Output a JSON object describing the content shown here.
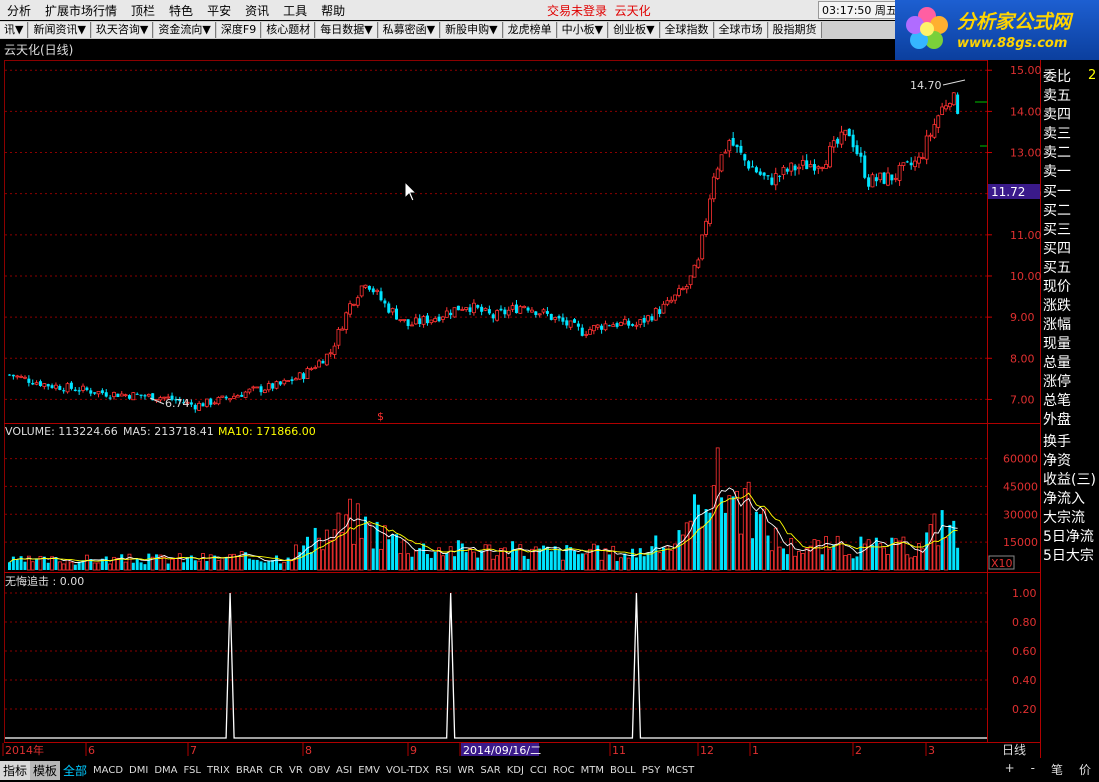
{
  "menubar": {
    "items": [
      "分析",
      "扩展市场行情",
      "顶栏",
      "特色",
      "平安",
      "资讯",
      "工具",
      "帮助"
    ],
    "login_status": "交易未登录",
    "stock_name": "云天化",
    "clock": "03:17:50 周五"
  },
  "logo": {
    "title": "分析家公式网",
    "url": "www.88gs.com"
  },
  "toolbar": {
    "items": [
      "讯▼",
      "新闻资讯▼",
      "玖天咨询▼",
      "资金流向▼",
      "深度F9",
      "核心题材",
      "每日数据▼",
      "私募密函▼",
      "新股申购▼",
      "龙虎榜单",
      "中小板▼",
      "创业板▼",
      "全球指数",
      "全球市场",
      "股指期货"
    ]
  },
  "chart_header": {
    "title": "云天化(日线)"
  },
  "price_chart": {
    "axis_ticks": [
      "15.00",
      "14.00",
      "13.00",
      "12.00",
      "11.00",
      "10.00",
      "9.00",
      "8.00",
      "7.00"
    ],
    "current_price": "11.72",
    "high_label": "14.70",
    "low_label": "6.74",
    "marker": "$"
  },
  "volume_chart": {
    "volume_label": "VOLUME: 113224.66",
    "ma5_label": "MA5: 213718.41",
    "ma10_label": "MA10: 171866.00",
    "axis_ticks": [
      "60000",
      "45000",
      "30000",
      "15000"
    ],
    "unit": "X10"
  },
  "indicator_chart": {
    "label": "无悔追击 : 0.00",
    "axis_ticks": [
      "1.00",
      "0.80",
      "0.60",
      "0.40",
      "0.20"
    ]
  },
  "date_axis": {
    "labels": [
      "2014年",
      "6",
      "7",
      "8",
      "9",
      "2014/09/16/二",
      "11",
      "12",
      "1",
      "2",
      "3"
    ],
    "period": "日线"
  },
  "quote_panel": {
    "labels": [
      "委比",
      "卖五",
      "卖四",
      "卖三",
      "卖二",
      "卖一",
      "买一",
      "买二",
      "买三",
      "买四",
      "买五",
      "现价",
      "涨跌",
      "涨幅",
      "现量",
      "总量",
      "涨停",
      "总笔",
      "外盘",
      "换手",
      "净资",
      "收益(三)",
      "净流入",
      "大宗流",
      "5日净流",
      "5日大宗"
    ],
    "ratio_value": "2"
  },
  "bottom_bar": {
    "tabs": [
      "指标",
      "模板"
    ],
    "active_filter": "全部",
    "indicators": [
      "MACD",
      "DMI",
      "DMA",
      "FSL",
      "TRIX",
      "BRAR",
      "CR",
      "VR",
      "OBV",
      "ASI",
      "EMV",
      "VOL-TDX",
      "RSI",
      "WR",
      "SAR",
      "KDJ",
      "CCI",
      "ROC",
      "MTM",
      "BOLL",
      "PSY",
      "MCST"
    ],
    "right_controls": [
      "+",
      "-",
      "笔",
      "价"
    ]
  },
  "colors": {
    "up": "#ff3232",
    "down": "#00e4ff",
    "grid": "#8b0000",
    "ma5": "#ffffff",
    "ma10": "#ffff00",
    "indicator": "#ffffff"
  },
  "chart_data": [
    {
      "type": "candlestick",
      "title": "云天化(日线)",
      "ylim": [
        6.5,
        15.2
      ],
      "ticks": [
        15,
        14,
        13,
        12,
        11,
        10,
        9,
        8,
        7
      ],
      "close_anchors": [
        [
          0,
          7.6
        ],
        [
          10,
          7.35
        ],
        [
          25,
          7.15
        ],
        [
          40,
          7.05
        ],
        [
          48,
          6.85
        ],
        [
          55,
          7.0
        ],
        [
          62,
          7.2
        ],
        [
          70,
          7.35
        ],
        [
          76,
          7.6
        ],
        [
          83,
          8.15
        ],
        [
          88,
          9.3
        ],
        [
          92,
          9.9
        ],
        [
          97,
          9.3
        ],
        [
          103,
          8.8
        ],
        [
          110,
          9.0
        ],
        [
          118,
          9.3
        ],
        [
          125,
          9.0
        ],
        [
          133,
          9.3
        ],
        [
          140,
          9.0
        ],
        [
          148,
          8.65
        ],
        [
          155,
          8.85
        ],
        [
          162,
          8.8
        ],
        [
          170,
          9.3
        ],
        [
          175,
          9.75
        ],
        [
          178,
          10.3
        ],
        [
          182,
          12.5
        ],
        [
          186,
          13.3
        ],
        [
          190,
          12.8
        ],
        [
          196,
          12.3
        ],
        [
          202,
          12.6
        ],
        [
          210,
          12.8
        ],
        [
          217,
          13.5
        ],
        [
          222,
          12.3
        ],
        [
          228,
          12.4
        ],
        [
          235,
          12.8
        ],
        [
          240,
          13.9
        ],
        [
          243,
          14.4
        ],
        [
          245,
          14.1
        ]
      ],
      "high": 14.7,
      "low": 6.74,
      "last": 11.72
    },
    {
      "type": "bar",
      "title": "VOLUME",
      "ylim": [
        0,
        70000
      ],
      "ticks": [
        60000,
        45000,
        30000,
        15000
      ],
      "vol_anchors": [
        [
          0,
          5000
        ],
        [
          70,
          7000
        ],
        [
          80,
          16000
        ],
        [
          88,
          27000
        ],
        [
          95,
          21000
        ],
        [
          105,
          12000
        ],
        [
          160,
          9000
        ],
        [
          175,
          17000
        ],
        [
          180,
          50000
        ],
        [
          186,
          44000
        ],
        [
          192,
          30000
        ],
        [
          200,
          13000
        ],
        [
          235,
          12000
        ],
        [
          242,
          30000
        ],
        [
          245,
          15000
        ]
      ],
      "ma5": 213718.41,
      "ma10": 171866.0
    },
    {
      "type": "line",
      "title": "无悔追击",
      "ylim": [
        0,
        1.0
      ],
      "ticks": [
        1.0,
        0.8,
        0.6,
        0.4,
        0.2
      ],
      "spikes": [
        57,
        114,
        162
      ]
    }
  ]
}
